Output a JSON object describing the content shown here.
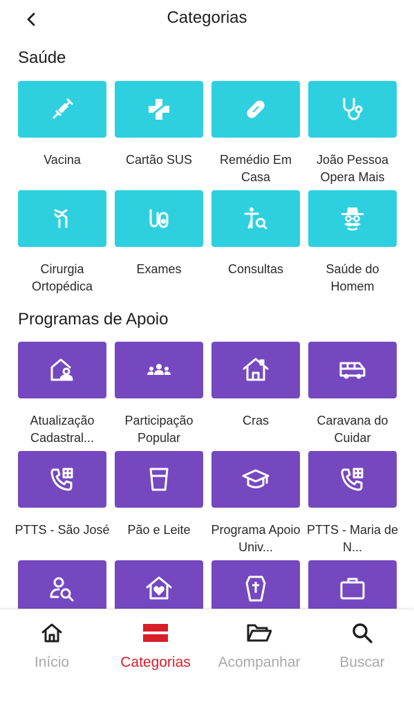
{
  "header": {
    "title": "Categorias"
  },
  "sections": [
    {
      "title": "Saúde",
      "items": [
        {
          "label": "Vacina",
          "icon": "syringe-icon"
        },
        {
          "label": "Cartão SUS",
          "icon": "medical-cross-icon"
        },
        {
          "label": "Remédio Em Casa",
          "icon": "pill-icon"
        },
        {
          "label": "João Pessoa Opera Mais",
          "icon": "stethoscope-icon"
        },
        {
          "label": "Cirurgia Ortopédica",
          "icon": "bone-joint-icon"
        },
        {
          "label": "Exames",
          "icon": "lab-tube-icon"
        },
        {
          "label": "Consultas",
          "icon": "person-search-icon"
        },
        {
          "label": "Saúde do Homem",
          "icon": "man-hat-mustache-icon"
        }
      ]
    },
    {
      "title": "Programas de Apoio",
      "items": [
        {
          "label": "Atualização Cadastral...",
          "icon": "house-user-icon"
        },
        {
          "label": "Participação Popular",
          "icon": "group-people-icon"
        },
        {
          "label": "Cras",
          "icon": "house-icon"
        },
        {
          "label": "Caravana do Cuidar",
          "icon": "van-icon"
        },
        {
          "label": "PTTS - São José",
          "icon": "phone-grid-icon"
        },
        {
          "label": "Pão e Leite",
          "icon": "glass-icon"
        },
        {
          "label": "Programa Apoio Univ...",
          "icon": "graduation-cap-icon"
        },
        {
          "label": "PTTS - Maria de N...",
          "icon": "phone-grid-icon"
        },
        {
          "label": "",
          "icon": "user-search-icon"
        },
        {
          "label": "",
          "icon": "house-heart-icon"
        },
        {
          "label": "",
          "icon": "coffin-icon"
        },
        {
          "label": "",
          "icon": "briefcase-icon"
        }
      ]
    }
  ],
  "bottom_nav": [
    {
      "label": "Início",
      "icon": "home-icon",
      "active": false
    },
    {
      "label": "Categorias",
      "icon": "categories-icon",
      "active": true
    },
    {
      "label": "Acompanhar",
      "icon": "folder-open-icon",
      "active": false
    },
    {
      "label": "Buscar",
      "icon": "search-icon",
      "active": false
    }
  ],
  "colors": {
    "saude_tile": "#2ed0e0",
    "apoio_tile": "#7548c0",
    "active_nav": "#d81e28",
    "inactive_nav": "#a9a9a9"
  }
}
